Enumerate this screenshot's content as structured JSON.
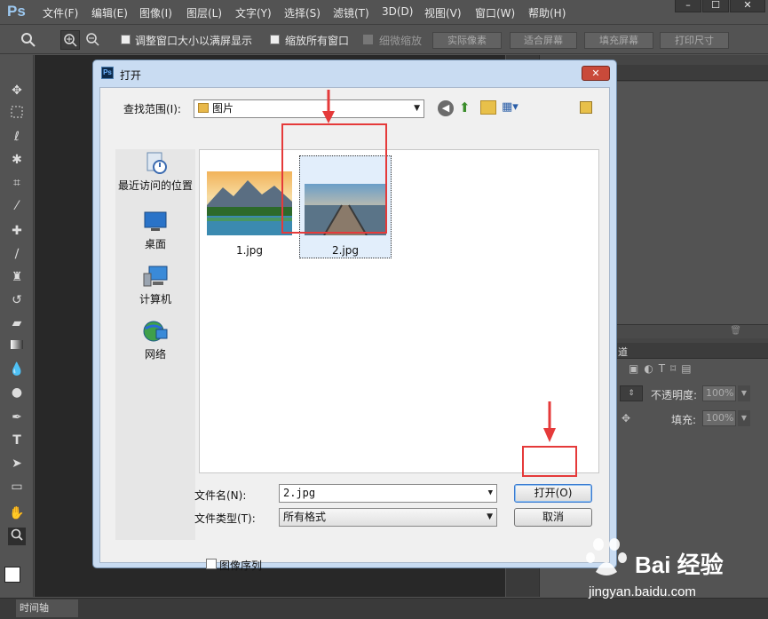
{
  "app": {
    "logo": "Ps",
    "menu": [
      "文件(F)",
      "编辑(E)",
      "图像(I)",
      "图层(L)",
      "文字(Y)",
      "选择(S)",
      "滤镜(T)",
      "3D(D)",
      "视图(V)",
      "窗口(W)",
      "帮助(H)"
    ],
    "window_buttons": [
      "–",
      "☐",
      "✕"
    ]
  },
  "options_bar": {
    "checkbox_1": "调整窗口大小以满屏显示",
    "checkbox_2": "缩放所有窗口",
    "checkbox_3": "细微缩放",
    "btn_actual": "实际像素",
    "btn_fit": "适合屏幕",
    "btn_fill": "填充屏幕",
    "btn_print": "打印尺寸"
  },
  "right_panel": {
    "channels_tab": "道",
    "opacity_label": "不透明度:",
    "opacity_value": "100%",
    "fill_label": "填充:",
    "fill_value": "100%"
  },
  "timeline": {
    "tab": "时间轴"
  },
  "dialog": {
    "title": "打开",
    "ps_icon": "Ps",
    "close": "✕",
    "lookin_label": "查找范围(I):",
    "lookin_value": "图片",
    "places": [
      "最近访问的位置",
      "桌面",
      "计算机",
      "网络"
    ],
    "files": [
      "1.jpg",
      "2.jpg"
    ],
    "filename_label": "文件名(N):",
    "filename_value": "2.jpg",
    "filetype_label": "文件类型(T):",
    "filetype_value": "所有格式",
    "open_button": "打开(O)",
    "cancel_button": "取消",
    "sequence_checkbox": "图像序列"
  },
  "watermark": {
    "brand": "Bai 经验",
    "url": "jingyan.baidu.com"
  },
  "colors": {
    "highlight_red": "#e53a3a",
    "dialog_frame": "#c9dcf2",
    "app_bg": "#535353"
  }
}
